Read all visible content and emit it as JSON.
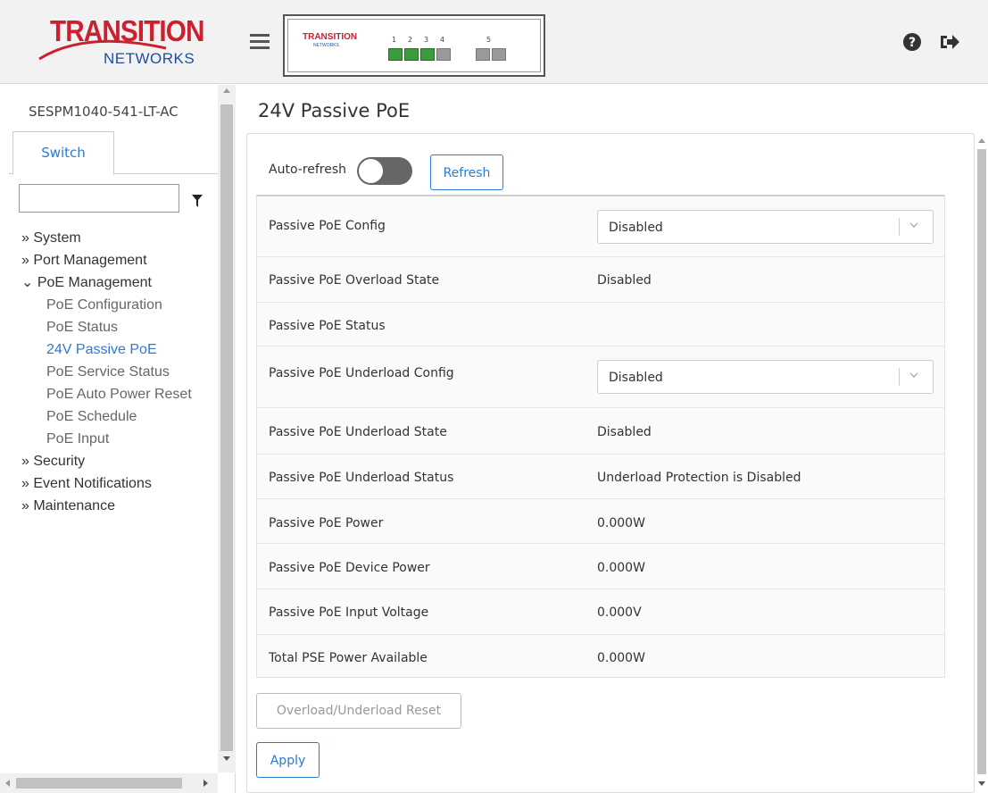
{
  "header": {
    "logo_text": "TRANSITION",
    "logo_subtext": "NETWORKS",
    "device_image": {
      "logo_text": "TRANSITION",
      "logo_subtext": "NETWORKS",
      "port_numbers": [
        "1",
        "2",
        "3",
        "4",
        "5"
      ]
    },
    "icons": [
      "menu-icon",
      "help-icon",
      "logout-icon"
    ]
  },
  "sidebar": {
    "device_name": "SESPM1040-541-LT-AC",
    "tab_label": "Switch",
    "filter_value": "",
    "nav": {
      "system": "» System",
      "port_management": "» Port Management",
      "poe_management": "⌄ PoE Management",
      "poe_configuration": "PoE Configuration",
      "poe_status": "PoE Status",
      "passive_poe_24v": "24V Passive PoE",
      "poe_service_status": "PoE Service Status",
      "poe_auto_power_reset": "PoE Auto Power Reset",
      "poe_schedule": "PoE Schedule",
      "poe_input": "PoE Input",
      "security": "» Security",
      "event_notifications": "» Event Notifications",
      "maintenance": "» Maintenance"
    },
    "active_item": "24V Passive PoE"
  },
  "main": {
    "title": "24V Passive PoE",
    "auto_refresh_label": "Auto-refresh",
    "auto_refresh_on": false,
    "refresh_label": "Refresh",
    "rows": [
      {
        "label": "Passive PoE Config",
        "type": "select",
        "value": "Disabled"
      },
      {
        "label": "Passive PoE Overload State",
        "type": "text",
        "value": "Disabled"
      },
      {
        "label": "Passive PoE Status",
        "type": "text",
        "value": ""
      },
      {
        "label": "Passive PoE Underload Config",
        "type": "select",
        "value": "Disabled"
      },
      {
        "label": "Passive PoE Underload State",
        "type": "text",
        "value": "Disabled"
      },
      {
        "label": "Passive PoE Underload Status",
        "type": "text",
        "value": "Underload Protection is Disabled"
      },
      {
        "label": "Passive PoE Power",
        "type": "text",
        "value": "0.000W"
      },
      {
        "label": "Passive PoE Device Power",
        "type": "text",
        "value": "0.000W"
      },
      {
        "label": "Passive PoE Input Voltage",
        "type": "text",
        "value": "0.000V"
      },
      {
        "label": "Total PSE Power Available",
        "type": "text",
        "value": "0.000W"
      }
    ],
    "reset_label": "Overload/Underload Reset",
    "apply_label": "Apply"
  },
  "colors": {
    "brand_red": "#cc1f2f",
    "brand_blue": "#1f4f9a",
    "link_blue": "#2a7ad6",
    "port_green": "#3a9c3a"
  }
}
